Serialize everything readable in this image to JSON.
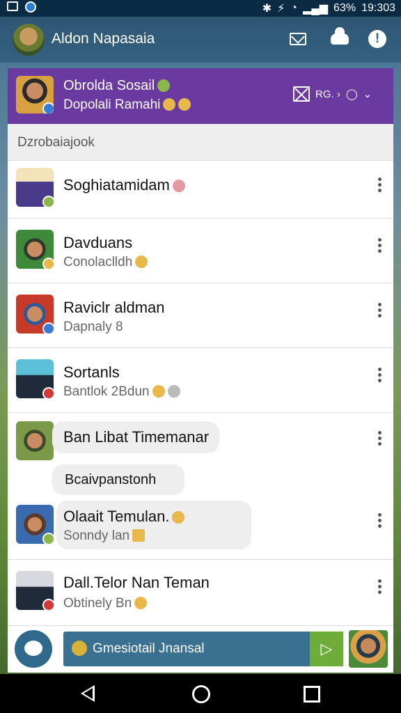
{
  "status": {
    "battery": "63%",
    "time": "19:303"
  },
  "app": {
    "title": "Aldon Napasaia"
  },
  "featured": {
    "name": "Obrolda Sosail",
    "sub": "Dopolali  Ramahi",
    "action_text": "RG. ›"
  },
  "section": {
    "title": "Dzrobaiajook"
  },
  "chats": [
    {
      "name": "Soghiatamidam",
      "message": ""
    },
    {
      "name": "Davduans",
      "message": "Conolaclldh"
    },
    {
      "name": "Raviclr aldman",
      "message": "Dapnaly 8"
    },
    {
      "name": "Sortanls",
      "message": "Bantlok 2Bdun"
    },
    {
      "name": "Ban Libat Timemanar",
      "message": ""
    },
    {
      "name": "Bcaivpanstonh",
      "message": ""
    },
    {
      "name": "Olaait  Temulan.",
      "message": "Sonndy lan"
    },
    {
      "name": "Dall.Telor Nan Teman",
      "message": "Obtinely Bn"
    }
  ],
  "composer": {
    "placeholder": "Gmesiotail Jnansal",
    "send_icon": "send-icon"
  },
  "colors": {
    "appbar": "#35627f",
    "featured": "#6a3aa0",
    "send": "#6fad3a"
  }
}
